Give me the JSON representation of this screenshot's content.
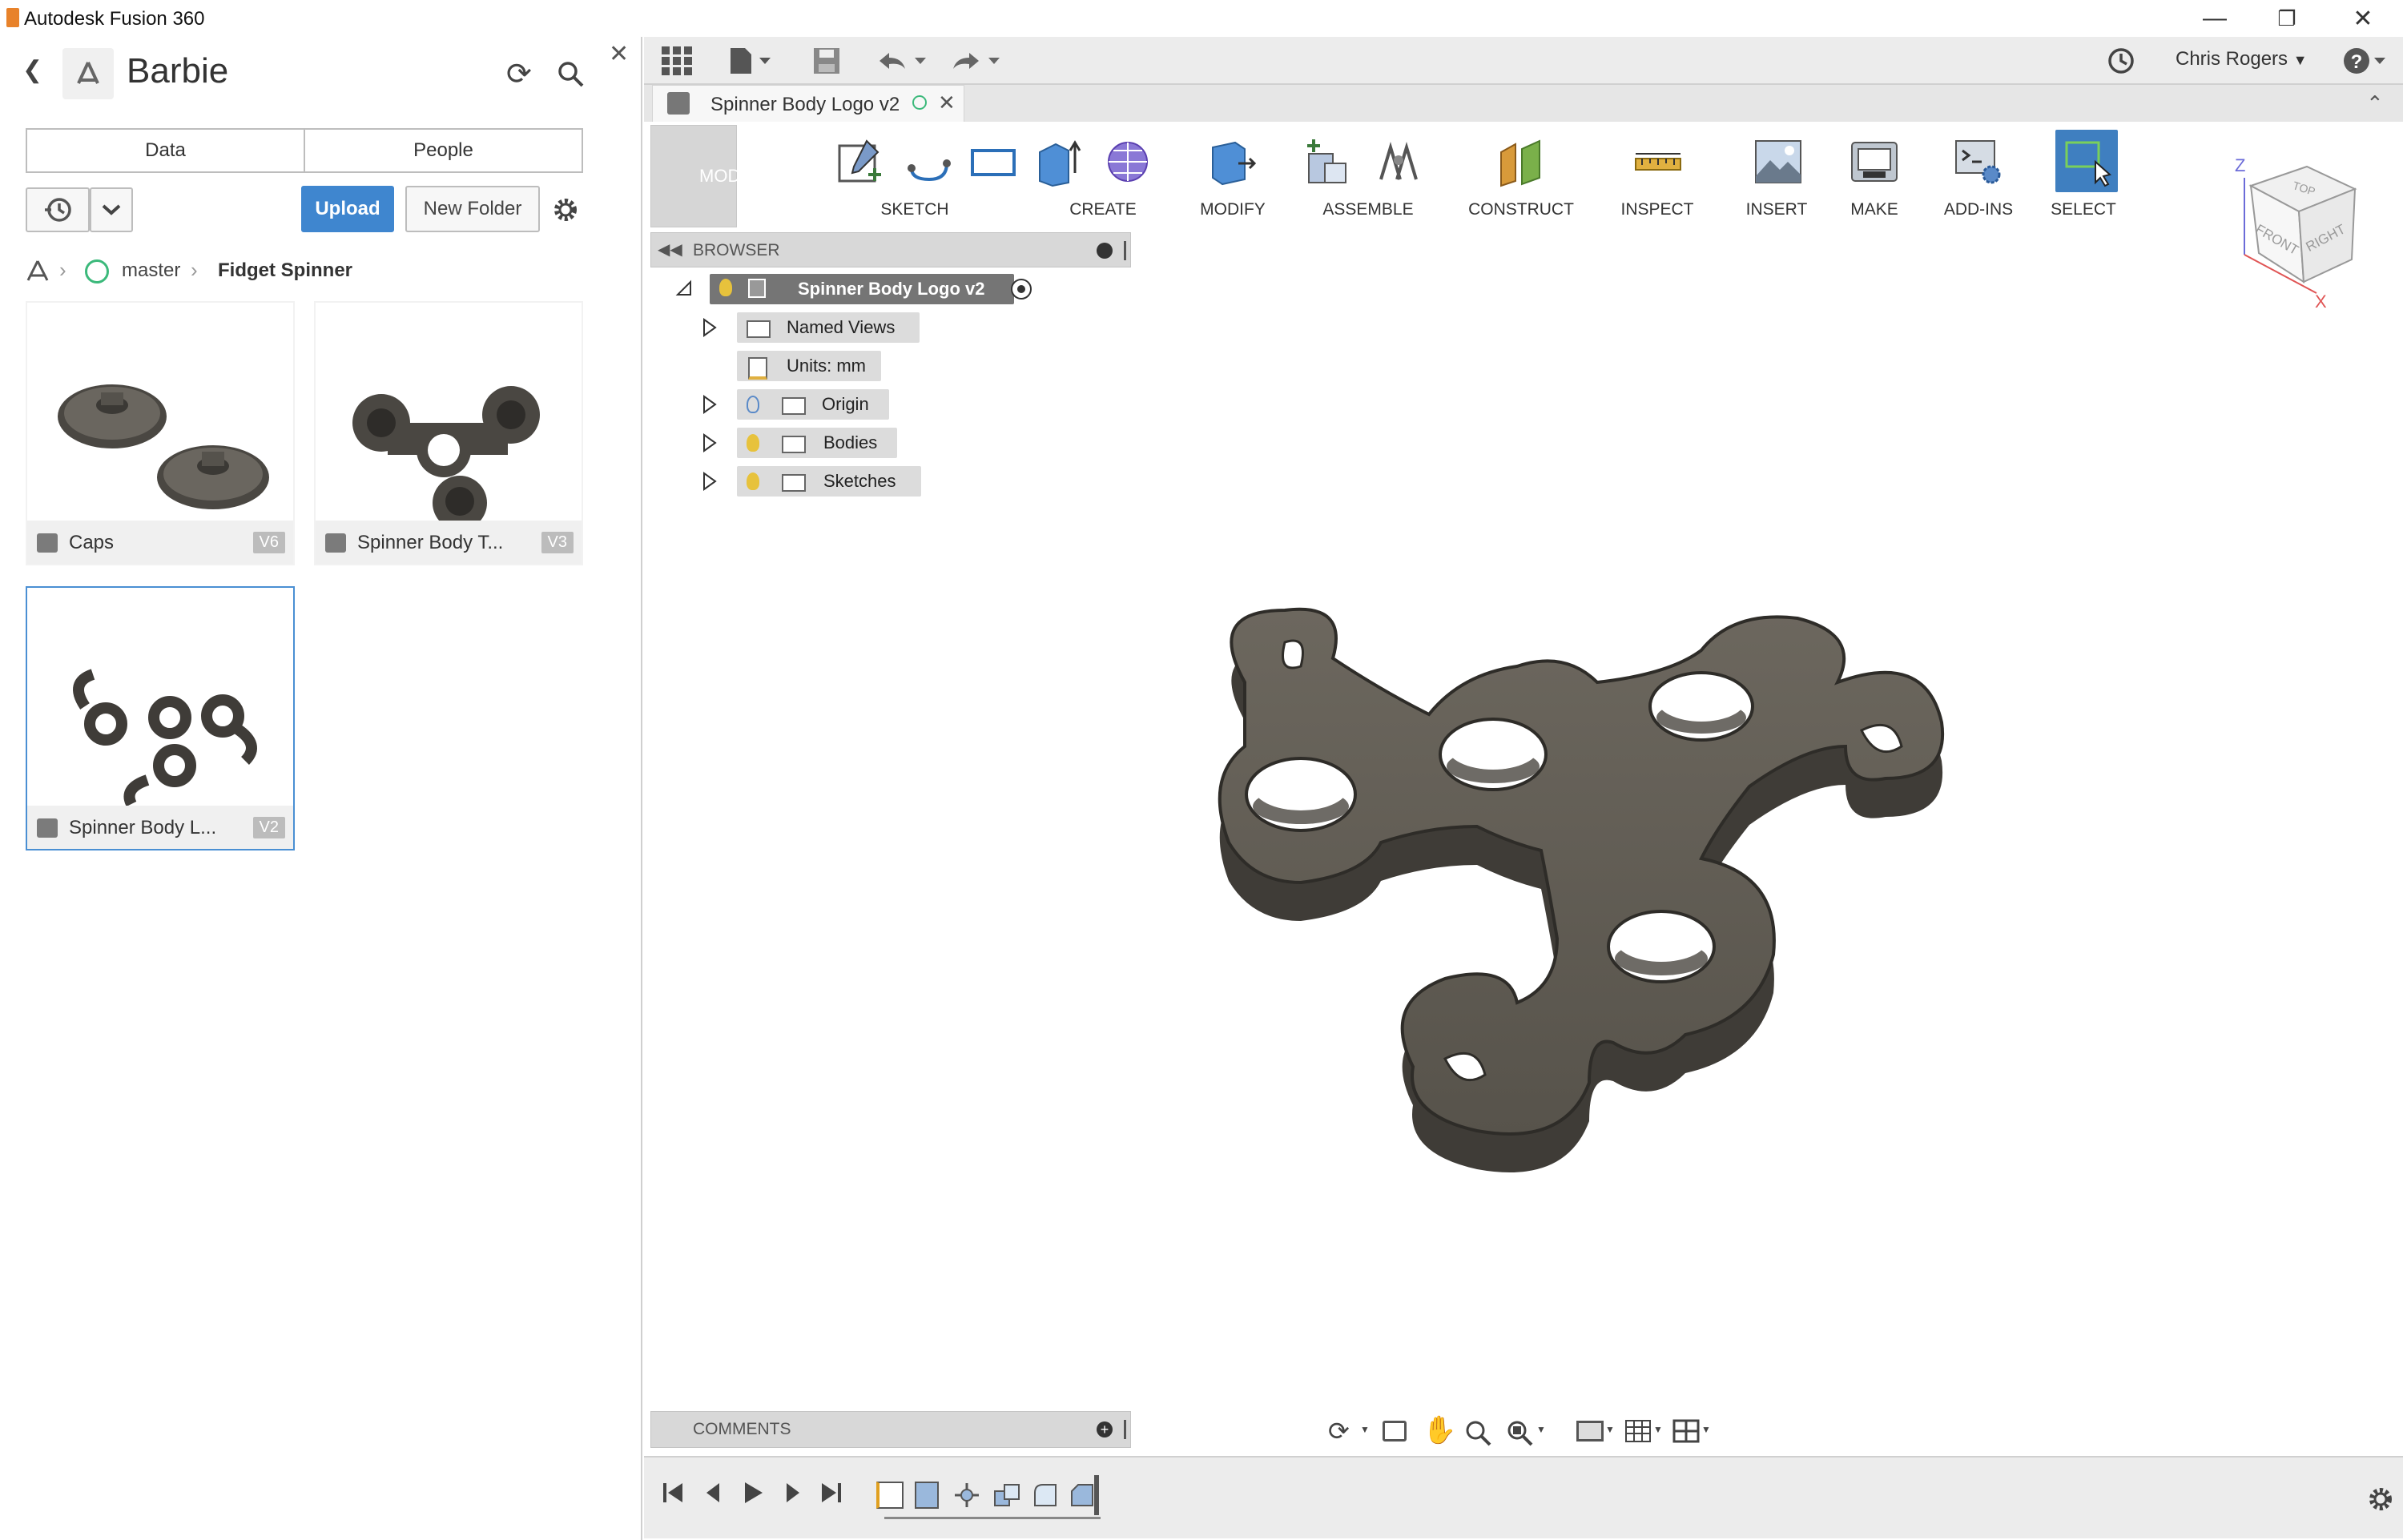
{
  "window": {
    "title": "Autodesk Fusion 360"
  },
  "left_panel": {
    "project": "Barbie",
    "tabs": [
      "Data",
      "People"
    ],
    "upload_label": "Upload",
    "new_folder_label": "New Folder",
    "breadcrumb": [
      "master",
      "Fidget Spinner"
    ],
    "files": [
      {
        "name": "Caps",
        "version": "V6"
      },
      {
        "name": "Spinner Body T...",
        "version": "V3"
      },
      {
        "name": "Spinner Body L...",
        "version": "V2"
      }
    ]
  },
  "quick_access": {
    "user": "Chris Rogers"
  },
  "document_tab": {
    "title": "Spinner Body Logo v2"
  },
  "toolbar": {
    "workspace": "MODEL",
    "groups": [
      "SKETCH",
      "CREATE",
      "MODIFY",
      "ASSEMBLE",
      "CONSTRUCT",
      "INSPECT",
      "INSERT",
      "MAKE",
      "ADD-INS",
      "SELECT"
    ]
  },
  "browser": {
    "title": "BROWSER",
    "root": "Spinner Body Logo v2",
    "items": [
      "Named Views",
      "Units: mm",
      "Origin",
      "Bodies",
      "Sketches"
    ]
  },
  "comments": {
    "title": "COMMENTS"
  },
  "viewcube": {
    "top": "TOP",
    "front": "FRONT",
    "right": "RIGHT",
    "z": "Z",
    "x": "X"
  },
  "colors": {
    "accent": "#4a8fd3",
    "select_active": "#3f7fc0",
    "body": "#5f5a52"
  }
}
